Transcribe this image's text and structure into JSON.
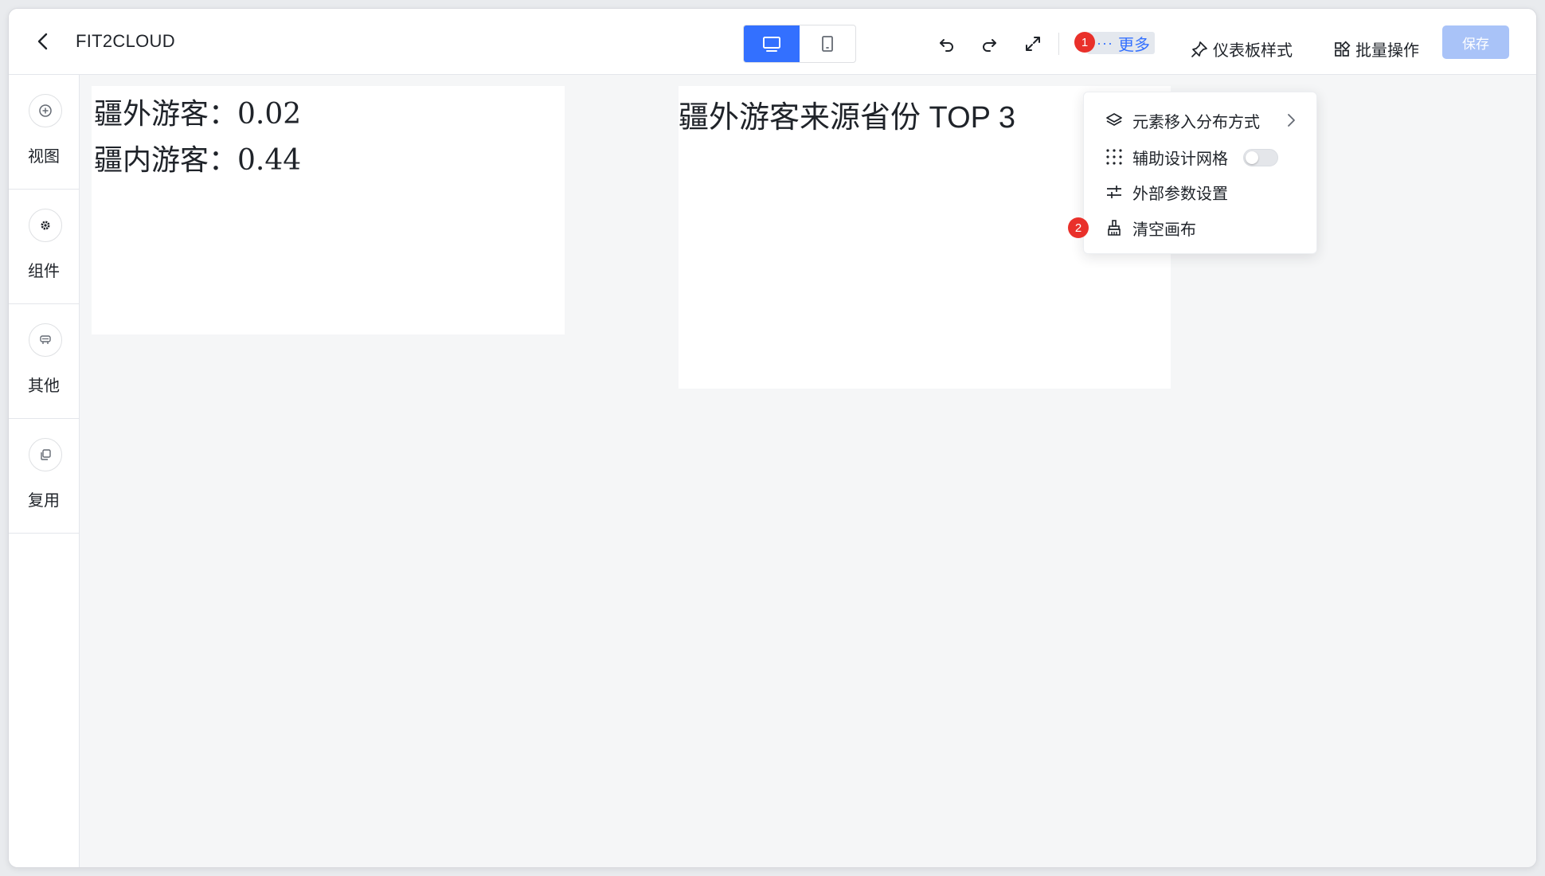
{
  "header": {
    "title": "FIT2CLOUD",
    "device_modes": [
      "pc-icon",
      "mobile-icon"
    ],
    "more_label": "更多",
    "more_badge": "1",
    "dashboard_style_label": "仪表板样式",
    "batch_label": "批量操作",
    "save_label": "保存",
    "accent_color": "#3370ff"
  },
  "sidebar": {
    "items": [
      {
        "label": "视图",
        "icon": "add-circle-icon"
      },
      {
        "label": "组件",
        "icon": "gear-icon"
      },
      {
        "label": "其他",
        "icon": "other-icon"
      },
      {
        "label": "复用",
        "icon": "copy-icon"
      }
    ]
  },
  "canvas": {
    "widget_text": {
      "line1": "疆外游客：0.02",
      "line2": "疆内游客：0.44"
    },
    "widget_chart": {
      "title": "疆外游客来源省份 TOP 3"
    }
  },
  "more_menu": {
    "items": [
      {
        "label": "元素移入分布方式",
        "icon": "layers-icon"
      },
      {
        "label": "辅助设计网格",
        "icon": "grid-dots-icon"
      },
      {
        "label": "外部参数设置",
        "icon": "sliders-icon"
      },
      {
        "label": "清空画布",
        "icon": "brush-icon"
      }
    ],
    "clear_badge": "2",
    "grid_toggle": "off"
  }
}
